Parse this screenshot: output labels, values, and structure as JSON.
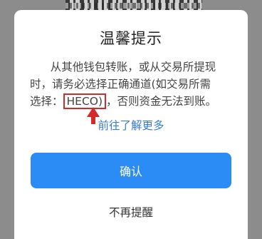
{
  "dialog": {
    "title": "温馨提示",
    "message": {
      "line1": "从其他钱包转账，或从交易所提现",
      "line2": "时，请务必选择正确通道(如交易所需",
      "line3_prefix": "选择：",
      "highlight": "HECO)",
      "line3_suffix": "，否则资金无法到账。"
    },
    "learn_more": "前往了解更多",
    "confirm_label": "确认",
    "dont_remind_label": "不再提醒"
  },
  "colors": {
    "accent": "#2b8cf5",
    "link": "#3a7bd5",
    "annotation_red": "#d42a2a"
  },
  "icons": {
    "annotation": "red-arrow-up-icon"
  }
}
